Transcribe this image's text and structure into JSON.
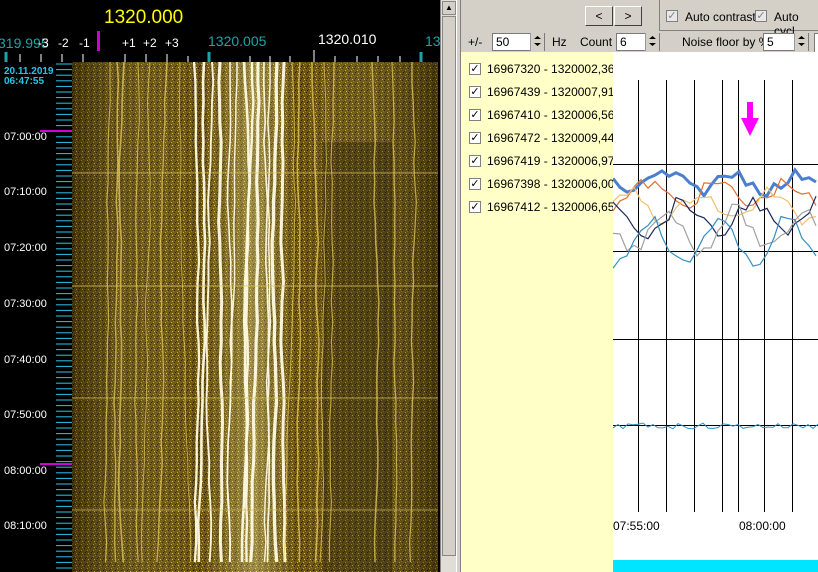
{
  "waterfall": {
    "center_frequency": "1320.000",
    "scale_labels": {
      "left_cut": "319.995",
      "offsets": [
        "-3",
        "-2",
        "-1",
        "+1",
        "+2",
        "+3"
      ],
      "mid": "1320.005",
      "right": "1320.010",
      "right_cut": "13"
    },
    "date": "20.11.2019",
    "start_time": "06:47:55",
    "time_labels": [
      "07:00:00",
      "07:10:00",
      "07:20:00",
      "07:30:00",
      "07:40:00",
      "07:50:00",
      "08:00:00",
      "08:10:00"
    ]
  },
  "toolbar": {
    "prev_label": "<",
    "next_label": ">",
    "auto_contrast_label": "Auto contrast",
    "auto_cycle_label": "Auto cycl",
    "pm_label": "+/-",
    "pm_value": "50",
    "hz_label": "Hz",
    "count_label": "Count",
    "count_value": "6",
    "noise_label": "Noise floor by %",
    "noise_value": "5"
  },
  "signals": [
    {
      "label": "16967320 - 1320002,36",
      "checked": true
    },
    {
      "label": "16967439 - 1320007,91",
      "checked": true
    },
    {
      "label": "16967410 - 1320006,56",
      "checked": true
    },
    {
      "label": "16967472 - 1320009,44",
      "checked": true
    },
    {
      "label": "16967419 - 1320006,97",
      "checked": true
    },
    {
      "label": "16967398 - 1320006,00",
      "checked": true
    },
    {
      "label": "16967412 - 1320006,65",
      "checked": true
    }
  ],
  "chart_data": {
    "type": "line",
    "x_tick_labels": [
      "07:55:00",
      "08:00:00"
    ],
    "grid": true,
    "marker_color": "#ff00ff",
    "highlight_bar_color": "#00e5ff",
    "series_colors": [
      "#4a7fd0",
      "#e07030",
      "#f0c070",
      "#1a2a5a",
      "#a0a0a0",
      "#3090c0"
    ]
  }
}
